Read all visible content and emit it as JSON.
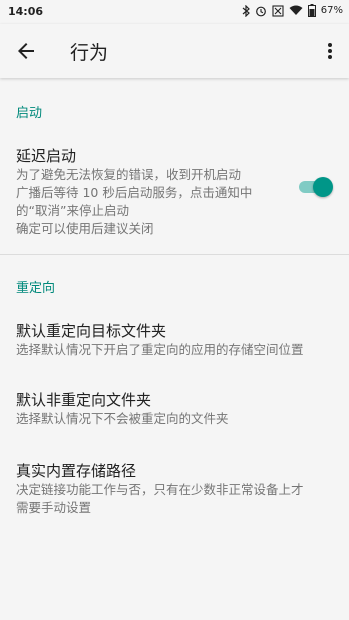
{
  "status_bar": {
    "time": "14:06",
    "battery": "67%"
  },
  "app_bar": {
    "title": "行为"
  },
  "sections": [
    {
      "header": "启动",
      "items": [
        {
          "title": "延迟启动",
          "summary_lines": [
            "为了避免无法恢复的错误，收到开机启动",
            "广播后等待 10 秒后启动服务，点击通知中",
            "的“取消”来停止启动",
            "确定可以使用后建议关闭"
          ],
          "switch_on": true
        }
      ]
    },
    {
      "header": "重定向",
      "items": [
        {
          "title": "默认重定向目标文件夹",
          "summary_lines": [
            "选择默认情况下开启了重定向的应用的存储空间位置"
          ]
        },
        {
          "title": "默认非重定向文件夹",
          "summary_lines": [
            "选择默认情况下不会被重定向的文件夹"
          ]
        },
        {
          "title": "真实内置存储路径",
          "summary_lines": [
            "决定链接功能工作与否，只有在少数非正常设备上才",
            "需要手动设置"
          ]
        }
      ]
    }
  ],
  "colors": {
    "accent": "#009688",
    "section_header": "#00897b",
    "background": "#f5f5f5"
  }
}
